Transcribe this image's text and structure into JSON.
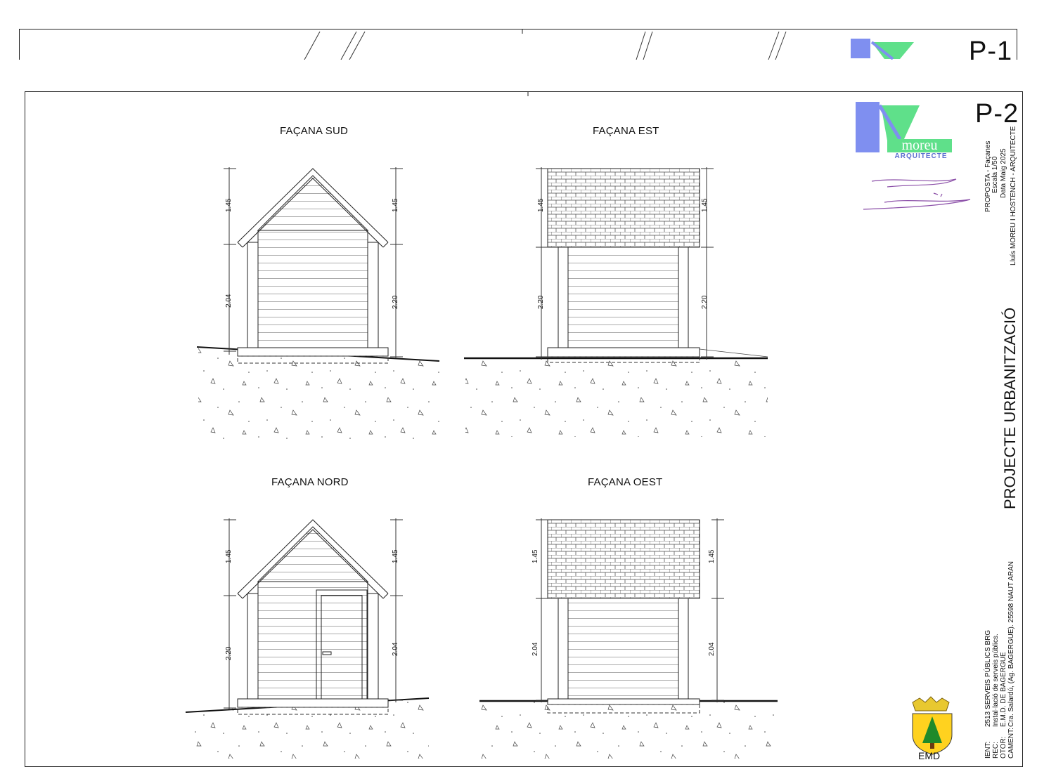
{
  "sheets": {
    "back": {
      "number": "P-1"
    },
    "front": {
      "number": "P-2"
    }
  },
  "logo": {
    "name": "moreu",
    "subtitle": "ARQUITECTE"
  },
  "drawing_info": {
    "line1": "PROPOSTA - Façanes",
    "line2": "Escala 1/50",
    "line3": "Data Maig 2025",
    "line4": "Lluís MOREU I HOSTENCH - ARQUITECTE"
  },
  "project_title": "PROJECTE URBANITZACIÓ",
  "project_info": {
    "line1": "2513 SERVEIS PÚBLICS BRG",
    "line2": "Instal·lació de serveis públics.",
    "line3": "E.M.D. DE BAGERGUE",
    "line4": "Cra. Salardú, (Ag. BAGERGUE). 25598 NAUT ARAN",
    "label1": "IENT:",
    "label2": "REC:",
    "label3": "OTOR:",
    "label4": "CAMENT:"
  },
  "crest_label": "EMD",
  "elevations": [
    {
      "title": "FAÇANA SUD",
      "dim_left_top": "1.45",
      "dim_left_bot": "2.04",
      "dim_right_top": "1.45",
      "dim_right_bot": "2.20"
    },
    {
      "title": "FAÇANA EST",
      "dim_left_top": "1.45",
      "dim_left_bot": "2.20",
      "dim_right_top": "1.45",
      "dim_right_bot": "2.20"
    },
    {
      "title": "FAÇANA NORD",
      "dim_left_top": "1.45",
      "dim_left_bot": "2.20",
      "dim_right_top": "1.45",
      "dim_right_bot": "2.04"
    },
    {
      "title": "FAÇANA OEST",
      "dim_left_top": "1.45",
      "dim_left_bot": "2.04",
      "dim_right_top": "1.45",
      "dim_right_bot": "2.04"
    }
  ]
}
